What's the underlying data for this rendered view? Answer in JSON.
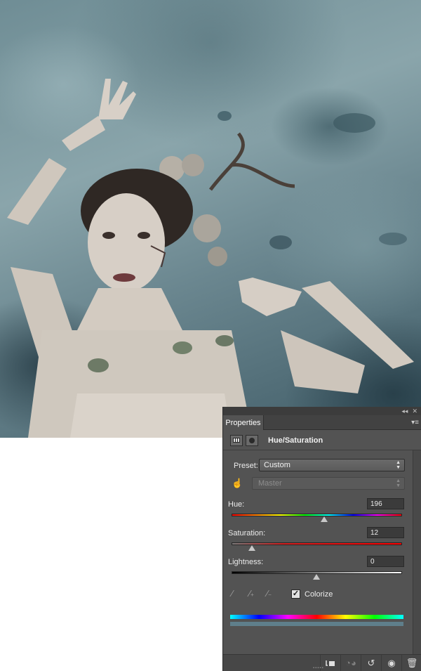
{
  "panel": {
    "tab_label": "Properties",
    "title": "Hue/Saturation",
    "preset_label": "Preset:",
    "preset_value": "Custom",
    "channel_value": "Master",
    "hue": {
      "label": "Hue:",
      "value": "196",
      "position": 0.54
    },
    "saturation": {
      "label": "Saturation:",
      "value": "12",
      "position": 0.11
    },
    "lightness": {
      "label": "Lightness:",
      "value": "0",
      "position": 0.5
    },
    "colorize_label": "Colorize",
    "colorize_checked": true
  },
  "colors": {
    "panel_bg": "#535353",
    "accent_bar": "#5f7f8b"
  },
  "icons": [
    "collapse-icon",
    "close-icon",
    "panel-menu-icon",
    "adjustment-layer-icon",
    "mask-icon",
    "targeted-adjust-icon",
    "eyedropper-icon",
    "eyedropper-plus-icon",
    "eyedropper-minus-icon",
    "clip-to-layer-icon",
    "view-previous-icon",
    "reset-icon",
    "visibility-eye-icon",
    "trash-icon"
  ]
}
